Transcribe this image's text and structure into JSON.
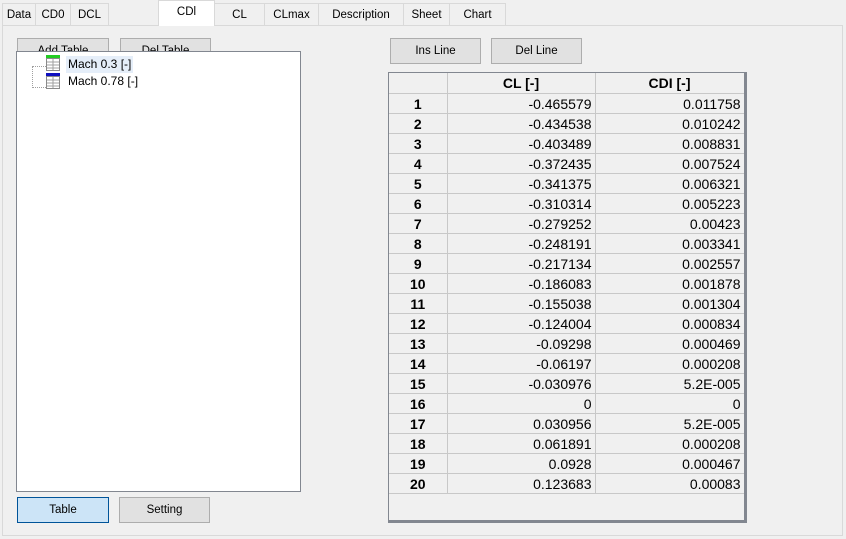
{
  "tabs": [
    {
      "label": "Data",
      "active": false
    },
    {
      "label": "CD0",
      "active": false
    },
    {
      "label": "DCL",
      "active": false
    },
    {
      "label": "CDl",
      "active": true
    },
    {
      "label": "CL",
      "active": false
    },
    {
      "label": "CLmax",
      "active": false
    },
    {
      "label": "Description",
      "active": false
    },
    {
      "label": "Sheet",
      "active": false
    },
    {
      "label": "Chart",
      "active": false
    }
  ],
  "left": {
    "add_table_label": "Add Table",
    "del_table_label": "Del Table",
    "tree": [
      {
        "label": "Mach 0.3 [-]",
        "icon": "table-icon",
        "icon_color": "#22cc22",
        "selected": true
      },
      {
        "label": "Mach 0.78 [-]",
        "icon": "table-icon",
        "icon_color": "#1010c0",
        "selected": false
      }
    ],
    "table_button_label": "Table",
    "setting_button_label": "Setting"
  },
  "right": {
    "ins_line_label": "Ins Line",
    "del_line_label": "Del Line",
    "columns": [
      "",
      "CL [-]",
      "CDI [-]"
    ],
    "rows": [
      [
        "1",
        "-0.465579",
        "0.011758"
      ],
      [
        "2",
        "-0.434538",
        "0.010242"
      ],
      [
        "3",
        "-0.403489",
        "0.008831"
      ],
      [
        "4",
        "-0.372435",
        "0.007524"
      ],
      [
        "5",
        "-0.341375",
        "0.006321"
      ],
      [
        "6",
        "-0.310314",
        "0.005223"
      ],
      [
        "7",
        "-0.279252",
        "0.00423"
      ],
      [
        "8",
        "-0.248191",
        "0.003341"
      ],
      [
        "9",
        "-0.217134",
        "0.002557"
      ],
      [
        "10",
        "-0.186083",
        "0.001878"
      ],
      [
        "11",
        "-0.155038",
        "0.001304"
      ],
      [
        "12",
        "-0.124004",
        "0.000834"
      ],
      [
        "13",
        "-0.09298",
        "0.000469"
      ],
      [
        "14",
        "-0.06197",
        "0.000208"
      ],
      [
        "15",
        "-0.030976",
        "5.2E-005"
      ],
      [
        "16",
        "0",
        "0"
      ],
      [
        "17",
        "0.030956",
        "5.2E-005"
      ],
      [
        "18",
        "0.061891",
        "0.000208"
      ],
      [
        "19",
        "0.0928",
        "0.000467"
      ],
      [
        "20",
        "0.123683",
        "0.00083"
      ]
    ]
  }
}
